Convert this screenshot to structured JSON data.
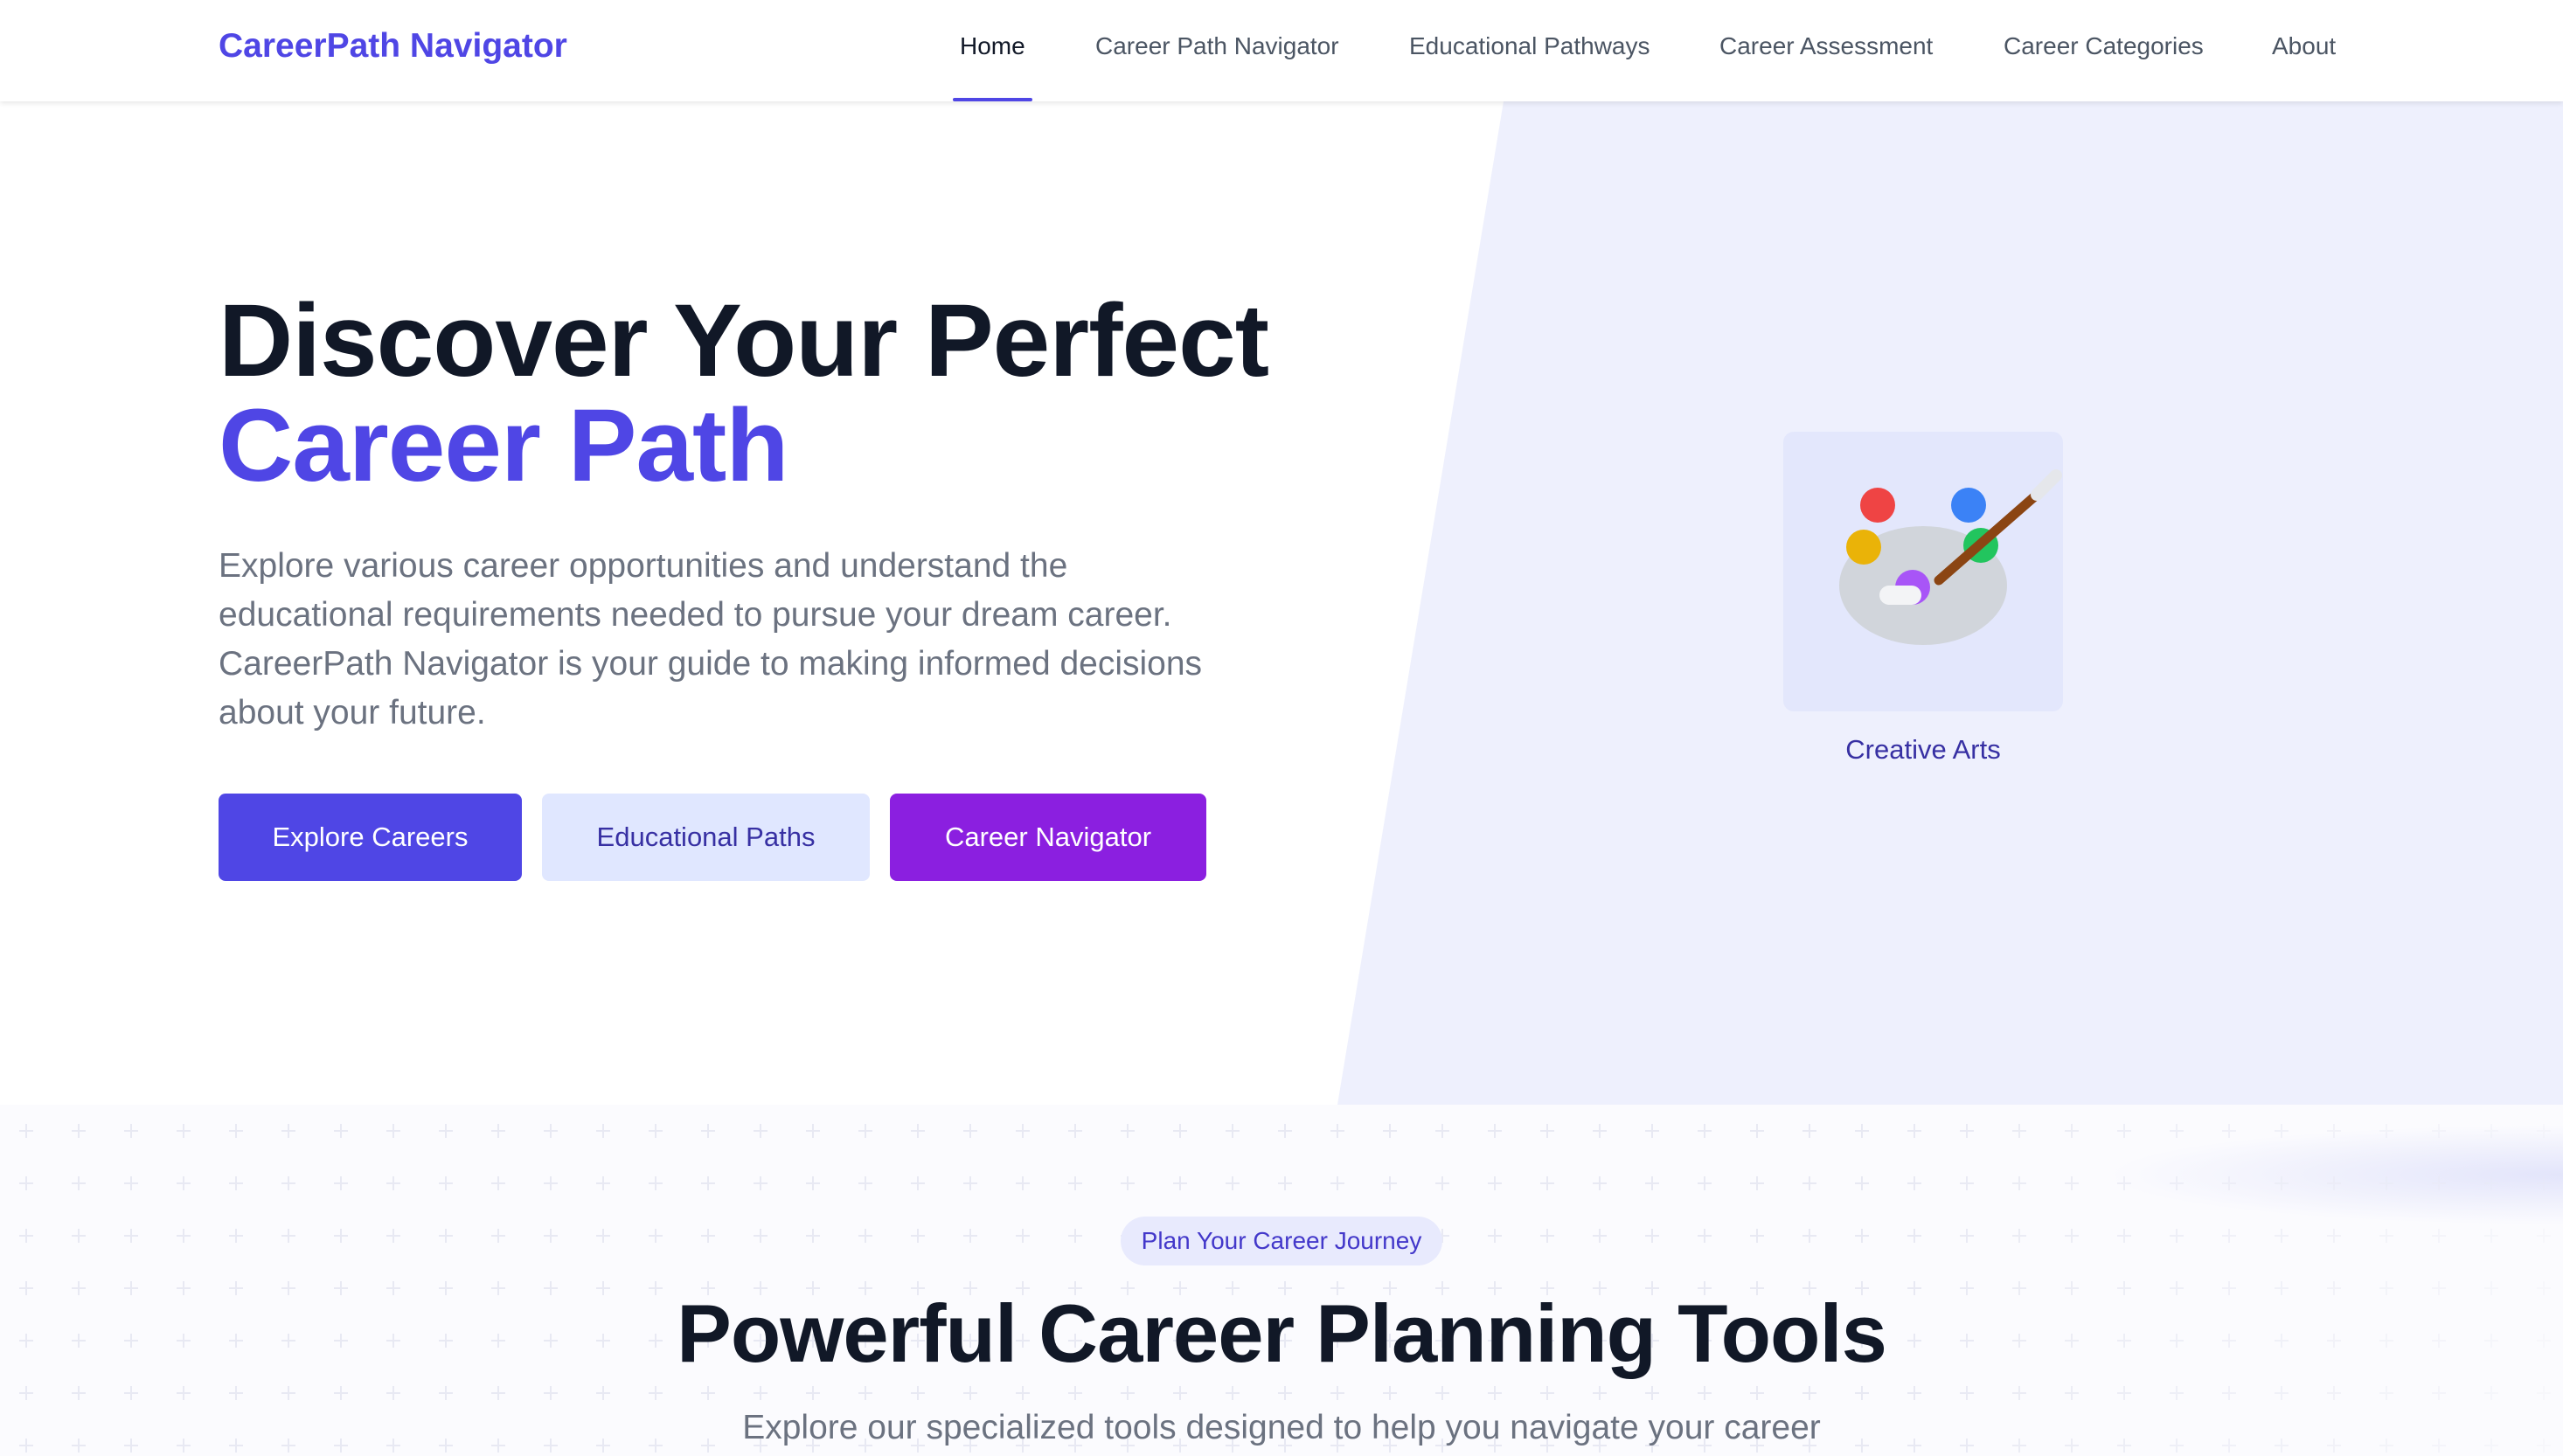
{
  "nav": {
    "brand": "CareerPath Navigator",
    "links": [
      {
        "label": "Home",
        "active": true
      },
      {
        "label": "Career Path Navigator",
        "active": false
      },
      {
        "label": "Educational Pathways",
        "active": false
      },
      {
        "label": "Career Assessment",
        "active": false
      },
      {
        "label": "Career Categories",
        "active": false
      },
      {
        "label": "About",
        "active": false
      }
    ]
  },
  "hero": {
    "title_line1": "Discover Your Perfect",
    "title_line2": "Career Path",
    "description": "Explore various career opportunities and understand the educational requirements needed to pursue your dream career. CareerPath Navigator is your guide to making informed decisions about your future.",
    "buttons": {
      "explore": "Explore Careers",
      "education": "Educational Paths",
      "navigator": "Career Navigator"
    },
    "featured_category": {
      "label": "Creative Arts",
      "icon": "palette-icon"
    }
  },
  "tools": {
    "badge": "Plan Your Career Journey",
    "title": "Powerful Career Planning Tools",
    "subtitle": "Explore our specialized tools designed to help you navigate your career"
  },
  "colors": {
    "accent": "#4f46e5",
    "secondary_bg": "#e0e7ff",
    "purple": "#8b1fe0",
    "hero_panel": "#eef0fd"
  }
}
